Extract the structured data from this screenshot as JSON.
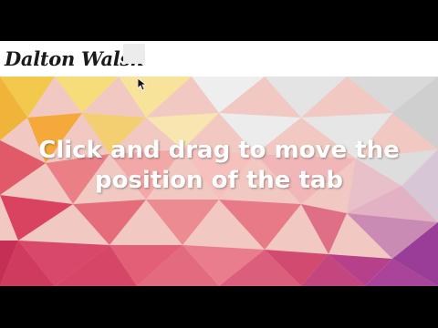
{
  "site": {
    "logo_text": "Dalton Walsh"
  },
  "overlay": {
    "caption_line_1": "Click and drag to move the",
    "caption_line_2": "position of the tab"
  },
  "icons": {
    "cursor": "mouse-pointer-icon"
  },
  "colors": {
    "header_background": "#ffffff",
    "caption_text": "#ffffff",
    "letterbox": "#000000"
  }
}
